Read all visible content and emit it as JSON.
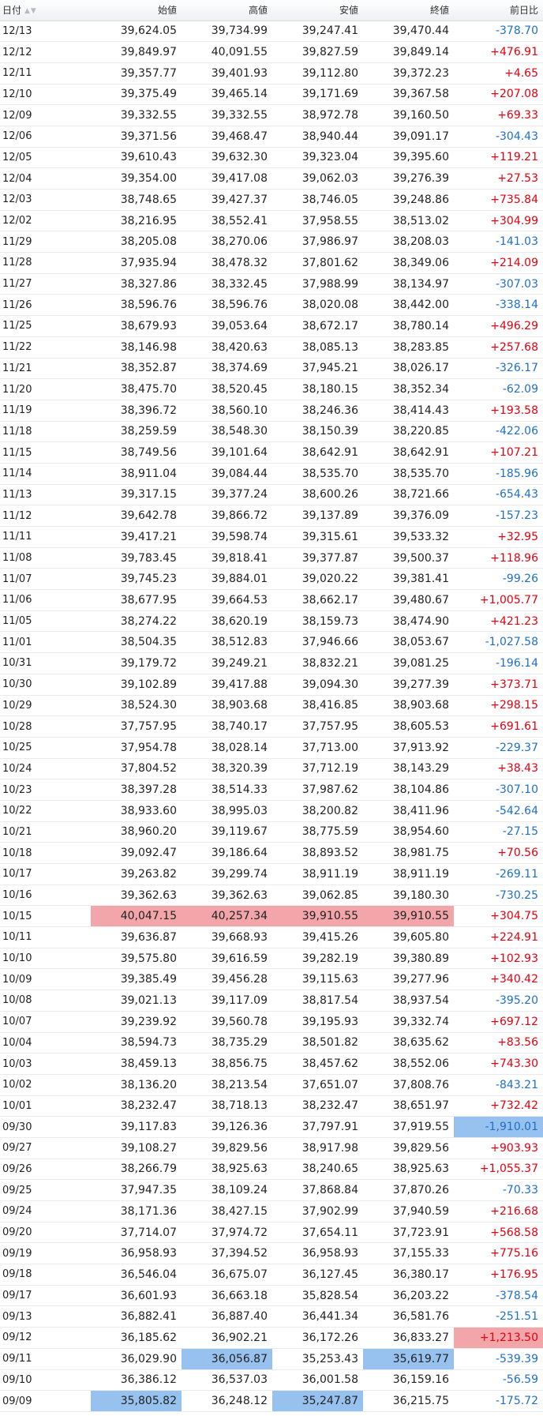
{
  "header": {
    "date": "日付",
    "open": "始値",
    "high": "高値",
    "low": "安値",
    "close": "終値",
    "change": "前日比",
    "sort_icon": "sort-up-down-icon"
  },
  "colors": {
    "positive": "#e3000f",
    "negative": "#1f6fc9",
    "highlight_max": "#f3a6aa",
    "highlight_min": "#97c1ef"
  },
  "rows": [
    {
      "date": "12/13",
      "open": "39,624.05",
      "high": "39,734.99",
      "low": "39,247.41",
      "close": "39,470.44",
      "change": "-378.70",
      "hl": {}
    },
    {
      "date": "12/12",
      "open": "39,849.97",
      "high": "40,091.55",
      "low": "39,827.59",
      "close": "39,849.14",
      "change": "+476.91",
      "hl": {}
    },
    {
      "date": "12/11",
      "open": "39,357.77",
      "high": "39,401.93",
      "low": "39,112.80",
      "close": "39,372.23",
      "change": "+4.65",
      "hl": {}
    },
    {
      "date": "12/10",
      "open": "39,375.49",
      "high": "39,465.14",
      "low": "39,171.69",
      "close": "39,367.58",
      "change": "+207.08",
      "hl": {}
    },
    {
      "date": "12/09",
      "open": "39,332.55",
      "high": "39,332.55",
      "low": "38,972.78",
      "close": "39,160.50",
      "change": "+69.33",
      "hl": {}
    },
    {
      "date": "12/06",
      "open": "39,371.56",
      "high": "39,468.47",
      "low": "38,940.44",
      "close": "39,091.17",
      "change": "-304.43",
      "hl": {}
    },
    {
      "date": "12/05",
      "open": "39,610.43",
      "high": "39,632.30",
      "low": "39,323.04",
      "close": "39,395.60",
      "change": "+119.21",
      "hl": {}
    },
    {
      "date": "12/04",
      "open": "39,354.00",
      "high": "39,417.08",
      "low": "39,062.03",
      "close": "39,276.39",
      "change": "+27.53",
      "hl": {}
    },
    {
      "date": "12/03",
      "open": "38,748.65",
      "high": "39,427.37",
      "low": "38,746.05",
      "close": "39,248.86",
      "change": "+735.84",
      "hl": {}
    },
    {
      "date": "12/02",
      "open": "38,216.95",
      "high": "38,552.41",
      "low": "37,958.55",
      "close": "38,513.02",
      "change": "+304.99",
      "hl": {}
    },
    {
      "date": "11/29",
      "open": "38,205.08",
      "high": "38,270.06",
      "low": "37,986.97",
      "close": "38,208.03",
      "change": "-141.03",
      "hl": {}
    },
    {
      "date": "11/28",
      "open": "37,935.94",
      "high": "38,478.32",
      "low": "37,801.62",
      "close": "38,349.06",
      "change": "+214.09",
      "hl": {}
    },
    {
      "date": "11/27",
      "open": "38,327.86",
      "high": "38,332.45",
      "low": "37,988.99",
      "close": "38,134.97",
      "change": "-307.03",
      "hl": {}
    },
    {
      "date": "11/26",
      "open": "38,596.76",
      "high": "38,596.76",
      "low": "38,020.08",
      "close": "38,442.00",
      "change": "-338.14",
      "hl": {}
    },
    {
      "date": "11/25",
      "open": "38,679.93",
      "high": "39,053.64",
      "low": "38,672.17",
      "close": "38,780.14",
      "change": "+496.29",
      "hl": {}
    },
    {
      "date": "11/22",
      "open": "38,146.98",
      "high": "38,420.63",
      "low": "38,085.13",
      "close": "38,283.85",
      "change": "+257.68",
      "hl": {}
    },
    {
      "date": "11/21",
      "open": "38,352.87",
      "high": "38,374.69",
      "low": "37,945.21",
      "close": "38,026.17",
      "change": "-326.17",
      "hl": {}
    },
    {
      "date": "11/20",
      "open": "38,475.70",
      "high": "38,520.45",
      "low": "38,180.15",
      "close": "38,352.34",
      "change": "-62.09",
      "hl": {}
    },
    {
      "date": "11/19",
      "open": "38,396.72",
      "high": "38,560.10",
      "low": "38,246.36",
      "close": "38,414.43",
      "change": "+193.58",
      "hl": {}
    },
    {
      "date": "11/18",
      "open": "38,259.59",
      "high": "38,548.30",
      "low": "38,150.39",
      "close": "38,220.85",
      "change": "-422.06",
      "hl": {}
    },
    {
      "date": "11/15",
      "open": "38,749.56",
      "high": "39,101.64",
      "low": "38,642.91",
      "close": "38,642.91",
      "change": "+107.21",
      "hl": {}
    },
    {
      "date": "11/14",
      "open": "38,911.04",
      "high": "39,084.44",
      "low": "38,535.70",
      "close": "38,535.70",
      "change": "-185.96",
      "hl": {}
    },
    {
      "date": "11/13",
      "open": "39,317.15",
      "high": "39,377.24",
      "low": "38,600.26",
      "close": "38,721.66",
      "change": "-654.43",
      "hl": {}
    },
    {
      "date": "11/12",
      "open": "39,642.78",
      "high": "39,866.72",
      "low": "39,137.89",
      "close": "39,376.09",
      "change": "-157.23",
      "hl": {}
    },
    {
      "date": "11/11",
      "open": "39,417.21",
      "high": "39,598.74",
      "low": "39,315.61",
      "close": "39,533.32",
      "change": "+32.95",
      "hl": {}
    },
    {
      "date": "11/08",
      "open": "39,783.45",
      "high": "39,818.41",
      "low": "39,377.87",
      "close": "39,500.37",
      "change": "+118.96",
      "hl": {}
    },
    {
      "date": "11/07",
      "open": "39,745.23",
      "high": "39,884.01",
      "low": "39,020.22",
      "close": "39,381.41",
      "change": "-99.26",
      "hl": {}
    },
    {
      "date": "11/06",
      "open": "38,677.95",
      "high": "39,664.53",
      "low": "38,662.17",
      "close": "39,480.67",
      "change": "+1,005.77",
      "hl": {}
    },
    {
      "date": "11/05",
      "open": "38,274.22",
      "high": "38,620.19",
      "low": "38,159.73",
      "close": "38,474.90",
      "change": "+421.23",
      "hl": {}
    },
    {
      "date": "11/01",
      "open": "38,504.35",
      "high": "38,512.83",
      "low": "37,946.66",
      "close": "38,053.67",
      "change": "-1,027.58",
      "hl": {}
    },
    {
      "date": "10/31",
      "open": "39,179.72",
      "high": "39,249.21",
      "low": "38,832.21",
      "close": "39,081.25",
      "change": "-196.14",
      "hl": {}
    },
    {
      "date": "10/30",
      "open": "39,102.89",
      "high": "39,417.88",
      "low": "39,094.30",
      "close": "39,277.39",
      "change": "+373.71",
      "hl": {}
    },
    {
      "date": "10/29",
      "open": "38,524.30",
      "high": "38,903.68",
      "low": "38,416.85",
      "close": "38,903.68",
      "change": "+298.15",
      "hl": {}
    },
    {
      "date": "10/28",
      "open": "37,757.95",
      "high": "38,740.17",
      "low": "37,757.95",
      "close": "38,605.53",
      "change": "+691.61",
      "hl": {}
    },
    {
      "date": "10/25",
      "open": "37,954.78",
      "high": "38,028.14",
      "low": "37,713.00",
      "close": "37,913.92",
      "change": "-229.37",
      "hl": {}
    },
    {
      "date": "10/24",
      "open": "37,804.52",
      "high": "38,320.39",
      "low": "37,712.19",
      "close": "38,143.29",
      "change": "+38.43",
      "hl": {}
    },
    {
      "date": "10/23",
      "open": "38,397.28",
      "high": "38,514.33",
      "low": "37,987.62",
      "close": "38,104.86",
      "change": "-307.10",
      "hl": {}
    },
    {
      "date": "10/22",
      "open": "38,933.60",
      "high": "38,995.03",
      "low": "38,200.82",
      "close": "38,411.96",
      "change": "-542.64",
      "hl": {}
    },
    {
      "date": "10/21",
      "open": "38,960.20",
      "high": "39,119.67",
      "low": "38,775.59",
      "close": "38,954.60",
      "change": "-27.15",
      "hl": {}
    },
    {
      "date": "10/18",
      "open": "39,092.47",
      "high": "39,186.64",
      "low": "38,893.52",
      "close": "38,981.75",
      "change": "+70.56",
      "hl": {}
    },
    {
      "date": "10/17",
      "open": "39,263.82",
      "high": "39,299.74",
      "low": "38,911.19",
      "close": "38,911.19",
      "change": "-269.11",
      "hl": {}
    },
    {
      "date": "10/16",
      "open": "39,362.63",
      "high": "39,362.63",
      "low": "39,062.85",
      "close": "39,180.30",
      "change": "-730.25",
      "hl": {}
    },
    {
      "date": "10/15",
      "open": "40,047.15",
      "high": "40,257.34",
      "low": "39,910.55",
      "close": "39,910.55",
      "change": "+304.75",
      "hl": {
        "open": "red",
        "high": "red",
        "low": "red",
        "close": "red"
      }
    },
    {
      "date": "10/11",
      "open": "39,636.87",
      "high": "39,668.93",
      "low": "39,415.26",
      "close": "39,605.80",
      "change": "+224.91",
      "hl": {}
    },
    {
      "date": "10/10",
      "open": "39,575.80",
      "high": "39,616.59",
      "low": "39,282.19",
      "close": "39,380.89",
      "change": "+102.93",
      "hl": {}
    },
    {
      "date": "10/09",
      "open": "39,385.49",
      "high": "39,456.28",
      "low": "39,115.63",
      "close": "39,277.96",
      "change": "+340.42",
      "hl": {}
    },
    {
      "date": "10/08",
      "open": "39,021.13",
      "high": "39,117.09",
      "low": "38,817.54",
      "close": "38,937.54",
      "change": "-395.20",
      "hl": {}
    },
    {
      "date": "10/07",
      "open": "39,239.92",
      "high": "39,560.78",
      "low": "39,195.93",
      "close": "39,332.74",
      "change": "+697.12",
      "hl": {}
    },
    {
      "date": "10/04",
      "open": "38,594.73",
      "high": "38,735.29",
      "low": "38,501.82",
      "close": "38,635.62",
      "change": "+83.56",
      "hl": {}
    },
    {
      "date": "10/03",
      "open": "38,459.13",
      "high": "38,856.75",
      "low": "38,457.62",
      "close": "38,552.06",
      "change": "+743.30",
      "hl": {}
    },
    {
      "date": "10/02",
      "open": "38,136.20",
      "high": "38,213.54",
      "low": "37,651.07",
      "close": "37,808.76",
      "change": "-843.21",
      "hl": {}
    },
    {
      "date": "10/01",
      "open": "38,232.47",
      "high": "38,718.13",
      "low": "38,232.47",
      "close": "38,651.97",
      "change": "+732.42",
      "hl": {}
    },
    {
      "date": "09/30",
      "open": "39,117.83",
      "high": "39,126.36",
      "low": "37,797.91",
      "close": "37,919.55",
      "change": "-1,910.01",
      "hl": {
        "change": "blue"
      }
    },
    {
      "date": "09/27",
      "open": "39,108.27",
      "high": "39,829.56",
      "low": "38,917.98",
      "close": "39,829.56",
      "change": "+903.93",
      "hl": {}
    },
    {
      "date": "09/26",
      "open": "38,266.79",
      "high": "38,925.63",
      "low": "38,240.65",
      "close": "38,925.63",
      "change": "+1,055.37",
      "hl": {}
    },
    {
      "date": "09/25",
      "open": "37,947.35",
      "high": "38,109.24",
      "low": "37,868.84",
      "close": "37,870.26",
      "change": "-70.33",
      "hl": {}
    },
    {
      "date": "09/24",
      "open": "38,171.36",
      "high": "38,427.15",
      "low": "37,902.99",
      "close": "37,940.59",
      "change": "+216.68",
      "hl": {}
    },
    {
      "date": "09/20",
      "open": "37,714.07",
      "high": "37,974.72",
      "low": "37,654.11",
      "close": "37,723.91",
      "change": "+568.58",
      "hl": {}
    },
    {
      "date": "09/19",
      "open": "36,958.93",
      "high": "37,394.52",
      "low": "36,958.93",
      "close": "37,155.33",
      "change": "+775.16",
      "hl": {}
    },
    {
      "date": "09/18",
      "open": "36,546.04",
      "high": "36,675.07",
      "low": "36,127.45",
      "close": "36,380.17",
      "change": "+176.95",
      "hl": {}
    },
    {
      "date": "09/17",
      "open": "36,601.93",
      "high": "36,663.18",
      "low": "35,828.54",
      "close": "36,203.22",
      "change": "-378.54",
      "hl": {}
    },
    {
      "date": "09/13",
      "open": "36,882.41",
      "high": "36,887.40",
      "low": "36,441.34",
      "close": "36,581.76",
      "change": "-251.51",
      "hl": {}
    },
    {
      "date": "09/12",
      "open": "36,185.62",
      "high": "36,902.21",
      "low": "36,172.26",
      "close": "36,833.27",
      "change": "+1,213.50",
      "hl": {
        "change": "red"
      }
    },
    {
      "date": "09/11",
      "open": "36,029.90",
      "high": "36,056.87",
      "low": "35,253.43",
      "close": "35,619.77",
      "change": "-539.39",
      "hl": {
        "high": "blue",
        "close": "blue"
      }
    },
    {
      "date": "09/10",
      "open": "36,386.12",
      "high": "36,537.03",
      "low": "36,001.58",
      "close": "36,159.16",
      "change": "-56.59",
      "hl": {}
    },
    {
      "date": "09/09",
      "open": "35,805.82",
      "high": "36,248.12",
      "low": "35,247.87",
      "close": "36,215.75",
      "change": "-175.72",
      "hl": {
        "open": "blue",
        "low": "blue"
      }
    }
  ]
}
